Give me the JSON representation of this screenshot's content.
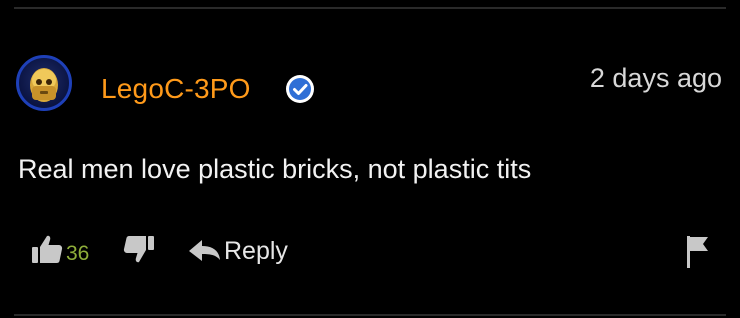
{
  "comment": {
    "username": "LegoC-3PO",
    "verified": true,
    "timestamp": "2 days ago",
    "text": "Real men love plastic bricks, not plastic tits",
    "likes": "36"
  },
  "actions": {
    "reply_label": "Reply"
  },
  "colors": {
    "background": "#000000",
    "username": "#ff9a1a",
    "verified_badge": "#2f6fd6",
    "like_count": "#8fae3a",
    "text": "#f2f2f2",
    "icons": "#c8c8c8"
  },
  "icons": {
    "avatar": "c3po-avatar",
    "verified": "verified-check-icon",
    "like": "thumbs-up-icon",
    "dislike": "thumbs-down-icon",
    "reply": "reply-arrow-icon",
    "report": "flag-icon"
  }
}
